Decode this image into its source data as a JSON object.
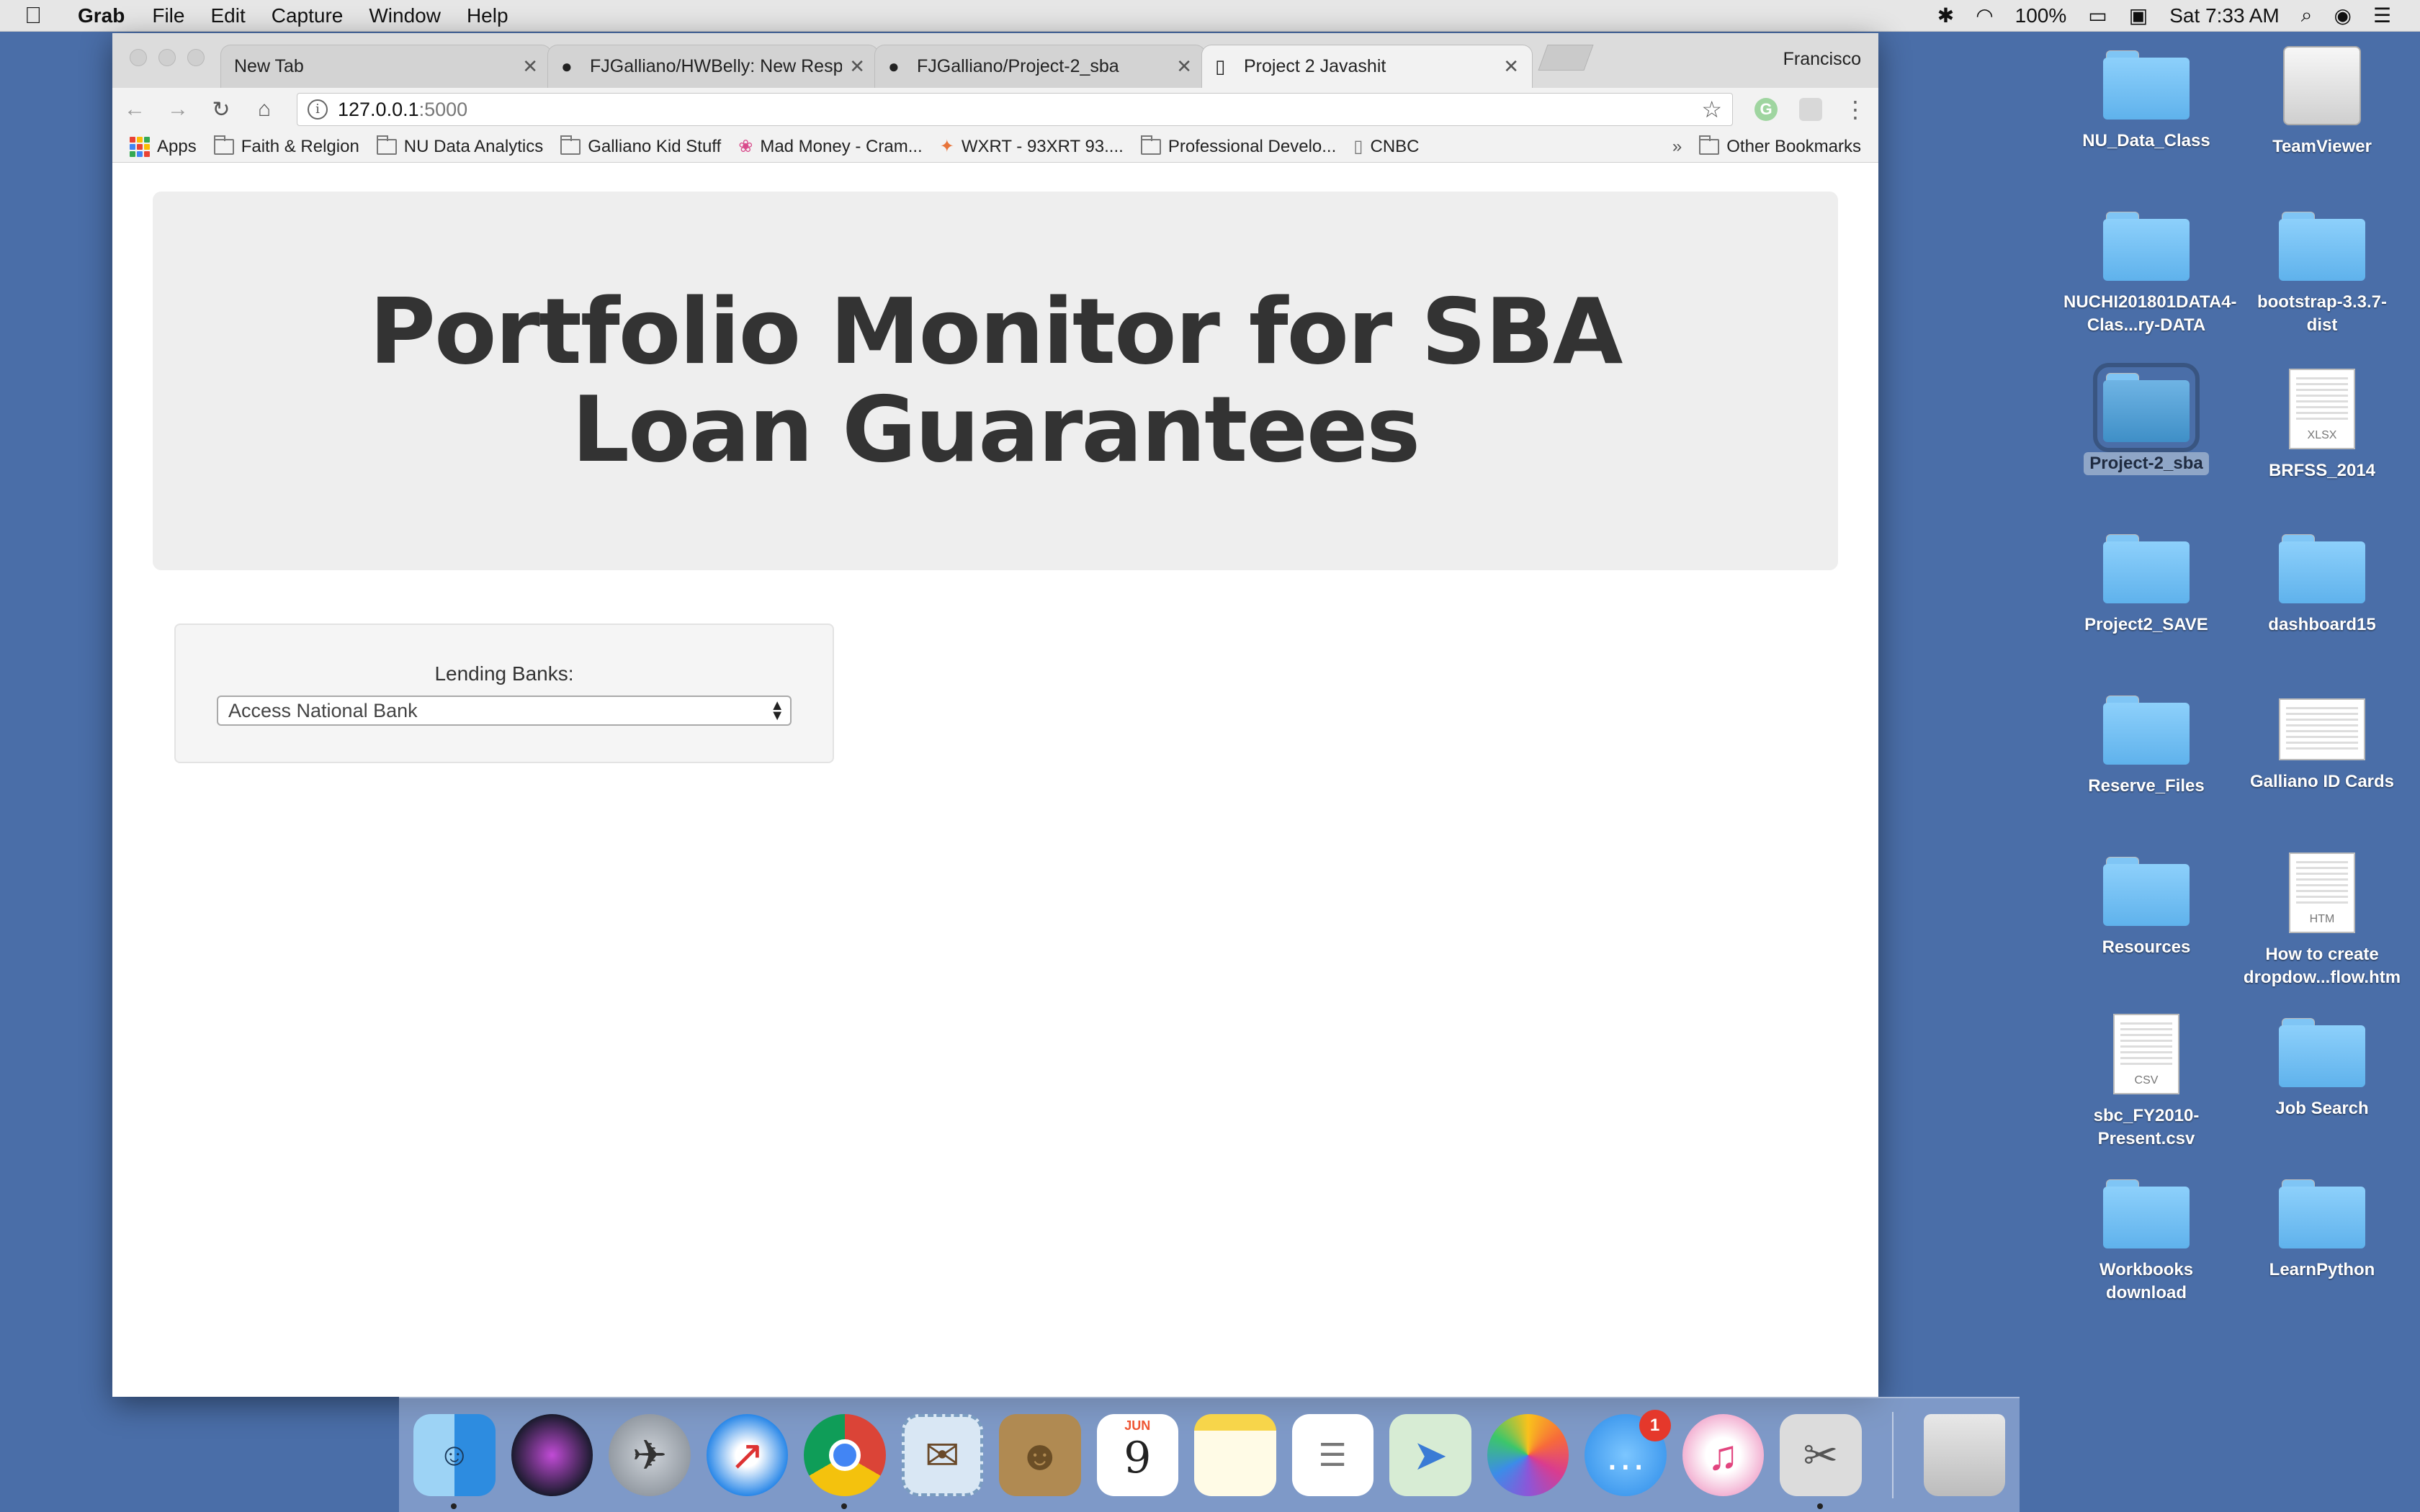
{
  "menubar": {
    "app_name": "Grab",
    "items": [
      "File",
      "Edit",
      "Capture",
      "Window",
      "Help"
    ],
    "battery": "100%",
    "clock": "Sat 7:33 AM"
  },
  "browser": {
    "profile": "Francisco",
    "tabs": [
      {
        "title": "New Tab",
        "icon": "none"
      },
      {
        "title": "FJGalliano/HWBelly: New Resp",
        "icon": "github-icon"
      },
      {
        "title": "FJGalliano/Project-2_sba",
        "icon": "github-icon"
      },
      {
        "title": "Project 2 Javashit",
        "icon": "document-icon"
      }
    ],
    "url_host": "127.0.0.1",
    "url_port": ":5000",
    "bookmarks": [
      {
        "label": "Apps",
        "icon": "apps-grid-icon"
      },
      {
        "label": "Faith & Relgion",
        "icon": "folder-icon"
      },
      {
        "label": "NU Data Analytics",
        "icon": "folder-icon"
      },
      {
        "label": "Galliano Kid Stuff",
        "icon": "folder-icon"
      },
      {
        "label": "Mad Money - Cram...",
        "icon": "peacock-icon"
      },
      {
        "label": "WXRT - 93XRT 93....",
        "icon": "radio-icon"
      },
      {
        "label": "Professional Develo...",
        "icon": "folder-icon"
      },
      {
        "label": "CNBC",
        "icon": "page-icon"
      }
    ],
    "bookmarks_more": "»",
    "other_bookmarks": "Other Bookmarks"
  },
  "page": {
    "title": "Portfolio Monitor for SBA Loan Guarantees",
    "select_label": "Lending Banks:",
    "select_value": "Access National Bank"
  },
  "desktop": [
    {
      "label": "NU_Data_Class",
      "kind": "folder"
    },
    {
      "label": "TeamViewer",
      "kind": "drive"
    },
    {
      "label": "NUCHI201801DATA4-Clas...ry-DATA",
      "kind": "folder"
    },
    {
      "label": "bootstrap-3.3.7-dist",
      "kind": "folder"
    },
    {
      "label": "Project-2_sba",
      "kind": "folder-selected"
    },
    {
      "label": "BRFSS_2014",
      "kind": "xlsx"
    },
    {
      "label": "Project2_SAVE",
      "kind": "folder"
    },
    {
      "label": "dashboard15",
      "kind": "folder"
    },
    {
      "label": "Reserve_Files",
      "kind": "folder"
    },
    {
      "label": "Galliano ID Cards",
      "kind": "image"
    },
    {
      "label": "Resources",
      "kind": "folder"
    },
    {
      "label": "How to create dropdow...flow.htm",
      "kind": "htm"
    },
    {
      "label": "sbc_FY2010-Present.csv",
      "kind": "csv"
    },
    {
      "label": "Job Search",
      "kind": "folder"
    },
    {
      "label": "Workbooks download",
      "kind": "folder"
    },
    {
      "label": "LearnPython",
      "kind": "folder"
    }
  ],
  "dock": {
    "calendar_month": "JUN",
    "calendar_day": "9",
    "messages_badge": "1"
  }
}
